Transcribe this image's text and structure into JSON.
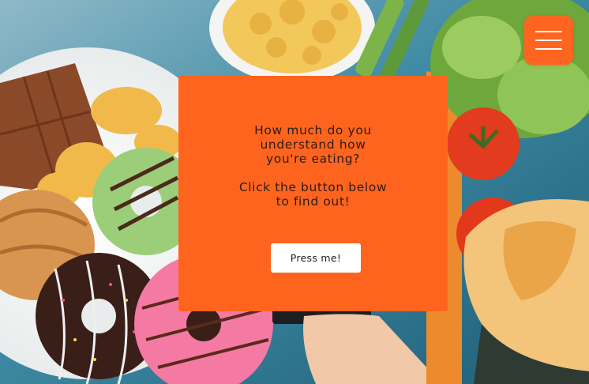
{
  "card": {
    "question_lines": [
      "How much do you",
      "understand how",
      "you're eating?"
    ],
    "cta_lines": [
      "Click the button below",
      "to find out!"
    ],
    "button_label": "Press me!"
  },
  "menu": {
    "icon": "hamburger-menu-icon"
  },
  "colors": {
    "accent": "#ff641e",
    "button_bg": "#ffffff"
  }
}
